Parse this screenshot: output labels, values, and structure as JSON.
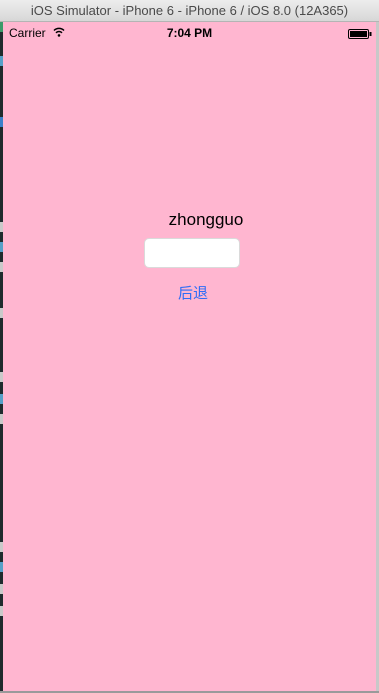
{
  "window": {
    "title": "iOS Simulator - iPhone 6 - iPhone 6 / iOS 8.0 (12A365)"
  },
  "statusbar": {
    "carrier": "Carrier",
    "time": "7:04 PM",
    "wifi_icon": "wifi-icon",
    "battery_icon": "battery-full-icon"
  },
  "content": {
    "label": "zhongguo",
    "input_value": "",
    "input_placeholder": "",
    "back_button_label": "后退"
  },
  "colors": {
    "screen_background": "#ffb6d0",
    "button_tint": "#2f6df6"
  }
}
